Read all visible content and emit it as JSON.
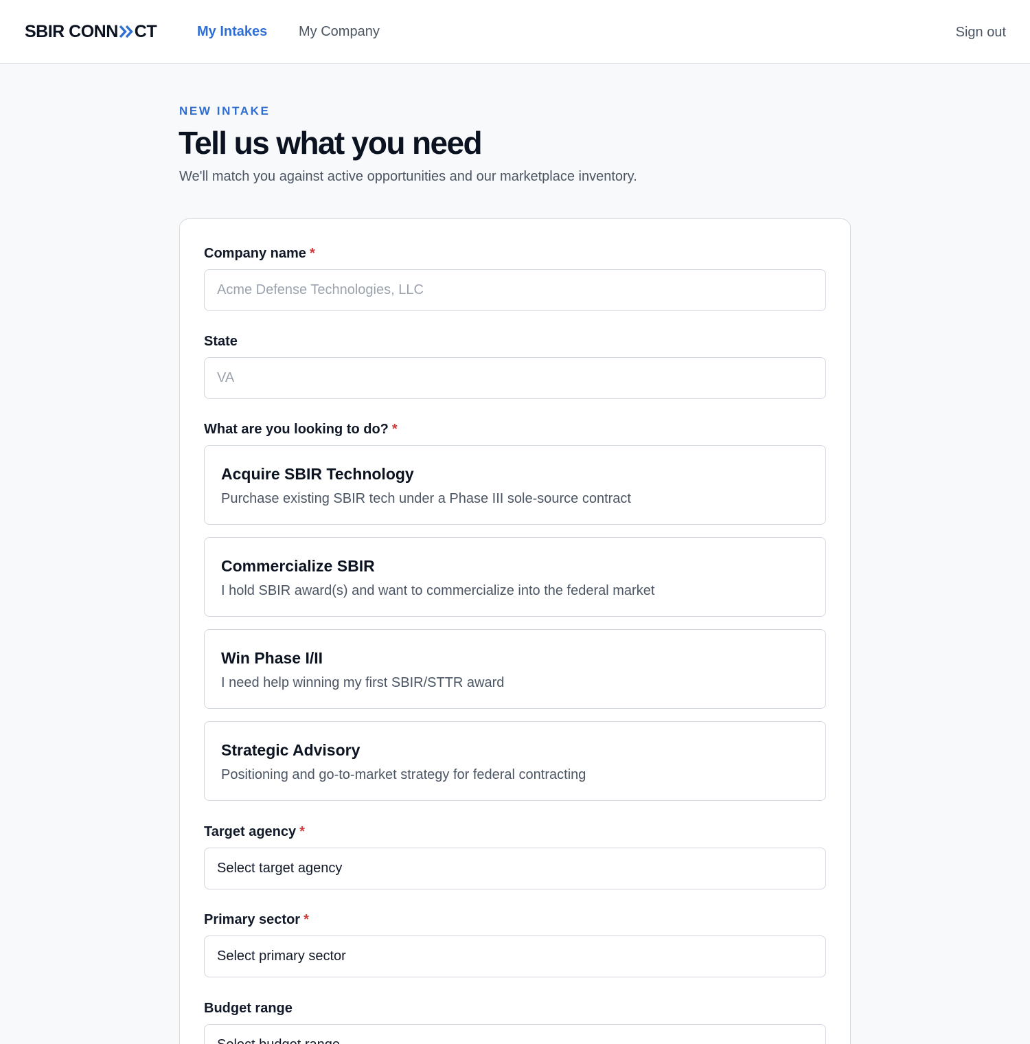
{
  "header": {
    "logo_left": "SBIR CONN",
    "logo_right": "CT",
    "nav": [
      {
        "label": "My Intakes",
        "active": true
      },
      {
        "label": "My Company",
        "active": false
      }
    ],
    "signout_label": "Sign out"
  },
  "page": {
    "eyebrow": "NEW INTAKE",
    "title": "Tell us what you need",
    "subtitle": "We'll match you against active opportunities and our marketplace inventory."
  },
  "form": {
    "company": {
      "label": "Company name",
      "required_mark": "*",
      "value": "",
      "placeholder": "Acme Defense Technologies, LLC"
    },
    "state": {
      "label": "State",
      "value": "",
      "placeholder": "VA"
    },
    "goal": {
      "label": "What are you looking to do?",
      "required_mark": "*",
      "options": [
        {
          "title": "Acquire SBIR Technology",
          "description": "Purchase existing SBIR tech under a Phase III sole-source contract"
        },
        {
          "title": "Commercialize SBIR",
          "description": "I hold SBIR award(s) and want to commercialize into the federal market"
        },
        {
          "title": "Win Phase I/II",
          "description": "I need help winning my first SBIR/STTR award"
        },
        {
          "title": "Strategic Advisory",
          "description": "Positioning and go-to-market strategy for federal contracting"
        }
      ]
    },
    "agency": {
      "label": "Target agency",
      "required_mark": "*",
      "selected": "Select target agency"
    },
    "sector": {
      "label": "Primary sector",
      "required_mark": "*",
      "selected": "Select primary sector"
    },
    "budget": {
      "label": "Budget range",
      "selected": "Select budget range"
    }
  },
  "colors": {
    "accent": "#2f6ed3",
    "required": "#d13b3b",
    "background": "#f8f9fb",
    "border": "#d3d7de"
  },
  "icons": {
    "logo_mark": "double-chevron-right-icon"
  }
}
